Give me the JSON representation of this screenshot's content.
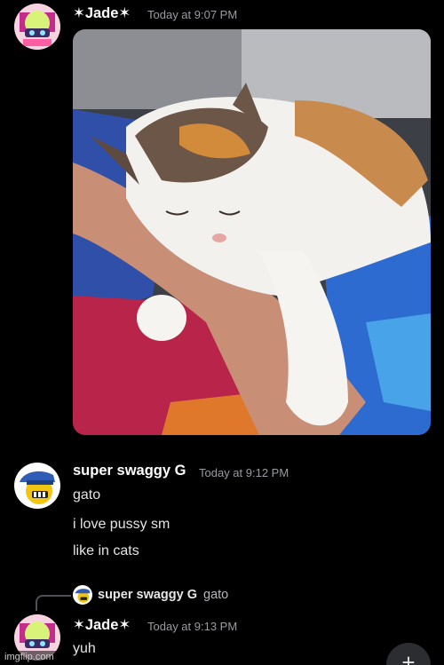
{
  "messages": [
    {
      "author": "✶Jade✶",
      "timestamp": "Today at 9:07 PM",
      "attachment": "cat-photo"
    },
    {
      "author": "super swaggy G",
      "timestamp": "Today at 9:12 PM",
      "lines": [
        "gato",
        "i love pussy sm",
        "like in cats"
      ]
    },
    {
      "reply_to": {
        "author": "super swaggy G",
        "text": "gato"
      },
      "author": "✶Jade✶",
      "timestamp": "Today at 9:13 PM",
      "lines": [
        "yuh"
      ]
    }
  ],
  "fab_icon": "plus-icon",
  "fab_label": "+",
  "watermark": "imgflip.com",
  "colors": {
    "background": "#000000",
    "timestamp": "#9a9ca3",
    "text": "#e4e4e6"
  }
}
